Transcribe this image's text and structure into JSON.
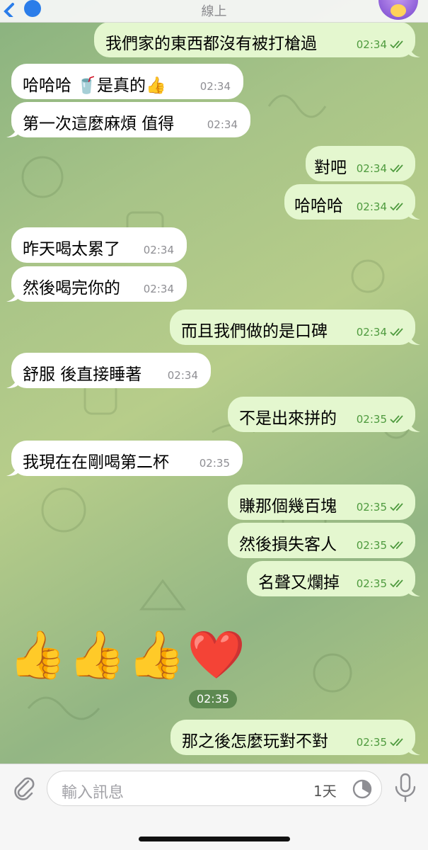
{
  "header": {
    "status": "線上"
  },
  "messages": [
    {
      "dir": "out",
      "text": "我們家的東西都沒有被打槍過",
      "time": "02:34"
    },
    {
      "dir": "in",
      "text": "哈哈哈 🥤是真的👍",
      "time": "02:34"
    },
    {
      "dir": "in",
      "text": "第一次這麼麻煩 值得",
      "time": "02:34"
    },
    {
      "dir": "out",
      "text": "對吧",
      "time": "02:34"
    },
    {
      "dir": "out",
      "text": "哈哈哈",
      "time": "02:34"
    },
    {
      "dir": "in",
      "text": "昨天喝太累了",
      "time": "02:34"
    },
    {
      "dir": "in",
      "text": "然後喝完你的",
      "time": "02:34"
    },
    {
      "dir": "out",
      "text": "而且我們做的是口碑",
      "time": "02:34"
    },
    {
      "dir": "in",
      "text": "舒服 後直接睡著",
      "time": "02:34"
    },
    {
      "dir": "out",
      "text": "不是出來拼的",
      "time": "02:35"
    },
    {
      "dir": "in",
      "text": "我現在在剛喝第二杯",
      "time": "02:35"
    },
    {
      "dir": "out",
      "text": "賺那個幾百塊",
      "time": "02:35"
    },
    {
      "dir": "out",
      "text": "然後損失客人",
      "time": "02:35"
    },
    {
      "dir": "out",
      "text": "名聲又爛掉",
      "time": "02:35"
    },
    {
      "dir": "out",
      "text": "那之後怎麼玩對不對",
      "time": "02:35"
    }
  ],
  "emoji_message": {
    "emojis": "👍👍👍❤️",
    "time": "02:35"
  },
  "input": {
    "placeholder": "輸入訊息",
    "timer_label": "1天"
  },
  "colors": {
    "incoming": "#ffffff",
    "outgoing": "#e4f7cf",
    "check": "#4e9a3e"
  }
}
